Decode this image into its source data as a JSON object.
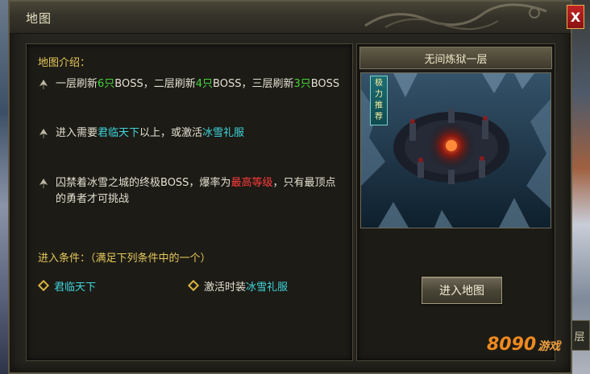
{
  "window": {
    "title": "地图",
    "close_label": "X"
  },
  "intro": {
    "title": "地图介绍：",
    "bullet1": {
      "p1": "一层刷新",
      "n1": "6只",
      "p2": "BOSS，二层刷新",
      "n2": "4只",
      "p3": "BOSS，三层刷新",
      "n3": "3只",
      "p4": "BOSS"
    },
    "bullet2": {
      "p1": "进入需要",
      "h1": "君临天下",
      "p2": "以上，或激活",
      "h2": "冰雪礼服"
    },
    "bullet3": {
      "p1": "囚禁着冰雪之城的终极BOSS，爆率为",
      "h1": "最高等级",
      "p2": "，只有最顶点的勇者才可挑战"
    }
  },
  "conditions": {
    "title": "进入条件：（满足下列条件中的一个）",
    "items": [
      {
        "label": "君临天下"
      },
      {
        "prefix": "激活时装",
        "highlight": "冰雪礼服"
      }
    ]
  },
  "map": {
    "name": "无间炼狱一层",
    "badge": [
      "极",
      "力",
      "推",
      "荐"
    ],
    "enter_label": "进入地图"
  },
  "right_tab": "层",
  "logo": {
    "main": "8090",
    "sub": "游戏"
  },
  "colors": {
    "highlight_green": "#47d23a",
    "highlight_cyan": "#3fd6dc",
    "highlight_red": "#ff3b3b",
    "section_gold": "#e6c95a"
  },
  "icons": [
    "arrow-bullet-icon",
    "diamond-bullet-icon",
    "close-icon",
    "dragon-ornament-icon"
  ]
}
